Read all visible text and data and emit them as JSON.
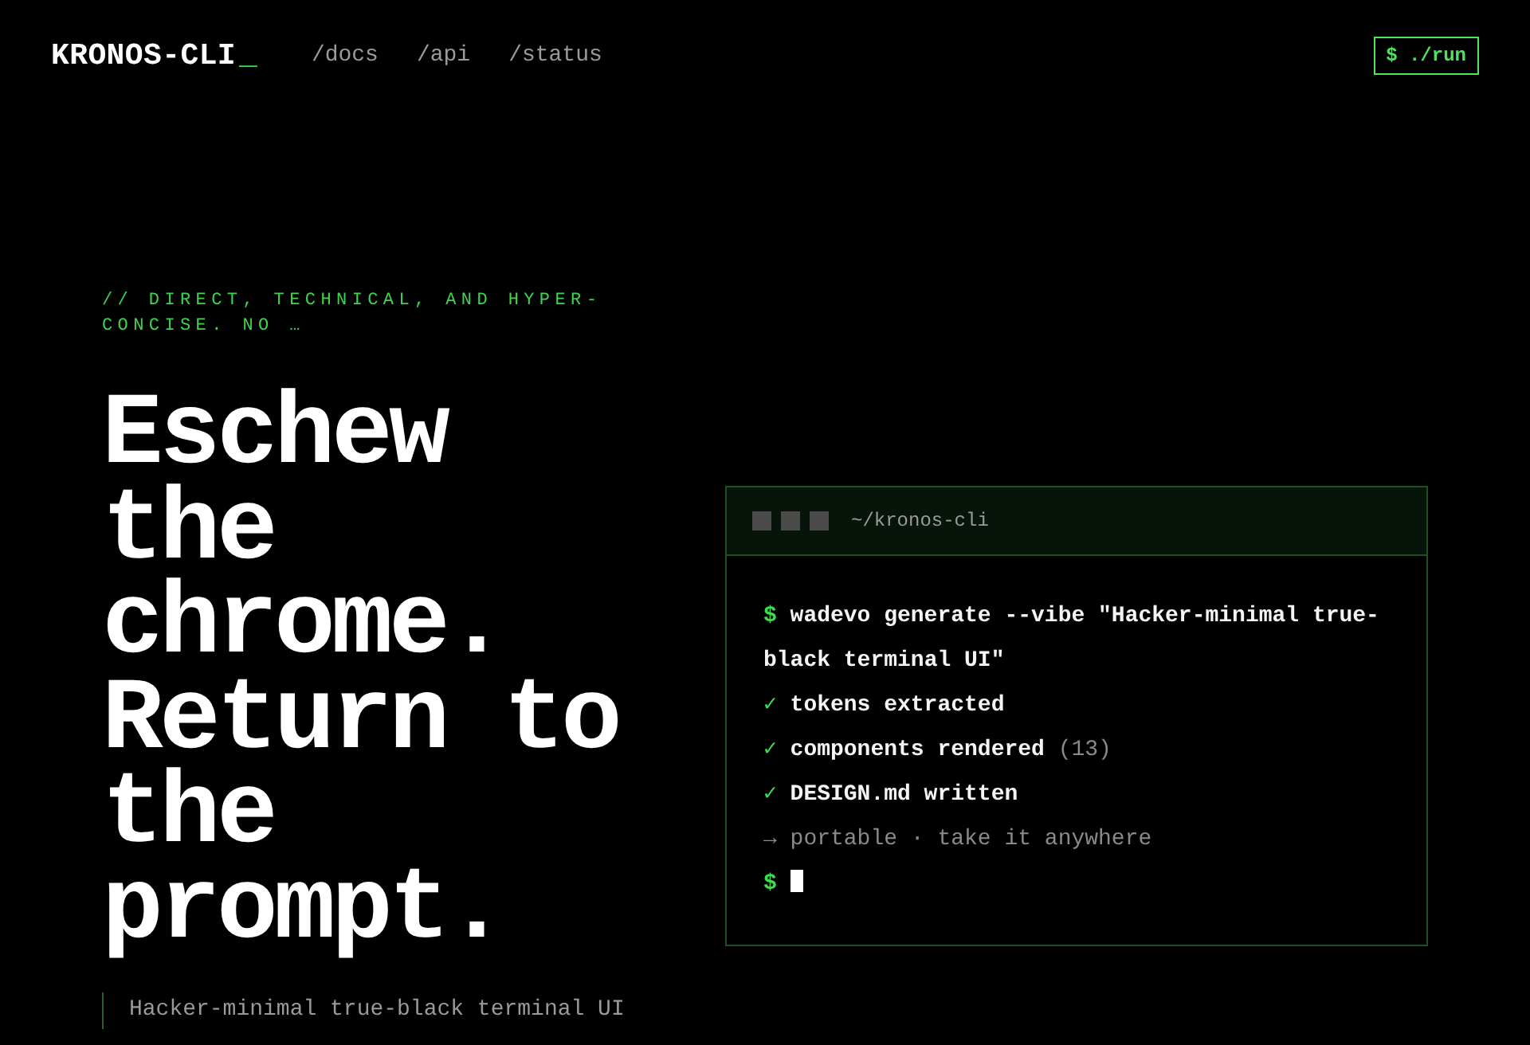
{
  "nav": {
    "logo": "KRONOS-CLI",
    "logo_cursor": "_",
    "links": [
      {
        "label": "/docs"
      },
      {
        "label": "/api"
      },
      {
        "label": "/status"
      }
    ],
    "run_button": "$ ./run"
  },
  "hero": {
    "eyebrow": "// DIRECT, TECHNICAL, AND HYPER-CONCISE. NO …",
    "headline": "Eschew the chrome. Return to the prompt.",
    "subtitle": "Hacker-minimal true-black terminal UI"
  },
  "terminal": {
    "path": "~/kronos-cli",
    "lines": [
      {
        "kind": "command",
        "prefix": "$",
        "text": "wadevo generate --vibe \"Hacker-minimal true-black terminal UI\""
      },
      {
        "kind": "success",
        "prefix": "✓",
        "text": "tokens extracted"
      },
      {
        "kind": "success",
        "prefix": "✓",
        "text": "components rendered",
        "note": "(13)"
      },
      {
        "kind": "success",
        "prefix": "✓",
        "text": "DESIGN.md written"
      },
      {
        "kind": "info",
        "prefix": "→",
        "text": "portable · take it anywhere"
      },
      {
        "kind": "prompt",
        "prefix": "$",
        "cursor": true
      }
    ]
  }
}
